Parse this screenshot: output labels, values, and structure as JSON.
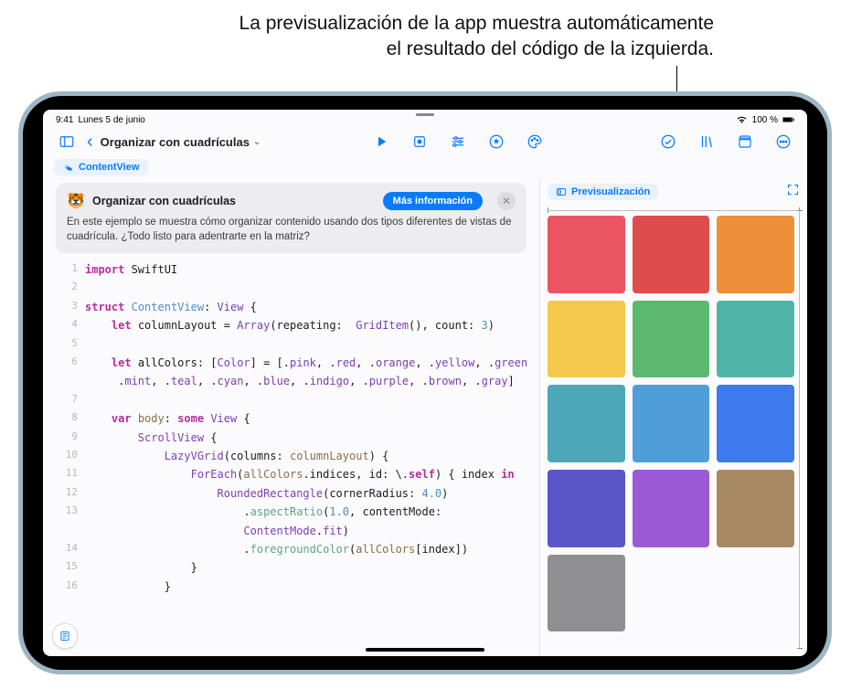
{
  "caption_line1": "La previsualización de la app muestra automáticamente",
  "caption_line2": "el resultado del código de la izquierda.",
  "status": {
    "time": "9:41",
    "date": "Lunes 5 de junio",
    "battery": "100 %",
    "wifi": "􀙇"
  },
  "doc_title": "Organizar con cuadrículas",
  "chips": {
    "contentview": "ContentView",
    "preview": "Previsualización"
  },
  "info": {
    "title": "Organizar con cuadrículas",
    "more": "Más información",
    "body": "En este ejemplo se muestra cómo organizar contenido usando dos tipos diferentes de vistas de cuadrícula. ¿Todo listo para adentrarte en la matriz?"
  },
  "code": {
    "lines": [
      {
        "n": "1",
        "html": "<span class='kw'>import</span> SwiftUI"
      },
      {
        "n": "2",
        "html": ""
      },
      {
        "n": "3",
        "html": "<span class='kw'>struct</span> <span class='type'>ContentView</span>: <span class='typeU'>View</span> {"
      },
      {
        "n": "4",
        "html": "    <span class='kw'>let</span> columnLayout = <span class='typeU'>Array</span>(repeating:  <span class='typeU'>GridItem</span>(), count: <span class='num'>3</span>)"
      },
      {
        "n": "5",
        "html": ""
      },
      {
        "n": "6",
        "html": "    <span class='kw'>let</span> allColors: [<span class='typeU'>Color</span>] = [.<span class='dot'>pink</span>, .<span class='dot'>red</span>, .<span class='dot'>orange</span>, .<span class='dot'>yellow</span>, .<span class='dot'>green</span>,"
      },
      {
        "n": "",
        "html": "     .<span class='dot'>mint</span>, .<span class='dot'>teal</span>, .<span class='dot'>cyan</span>, .<span class='dot'>blue</span>, .<span class='dot'>indigo</span>, .<span class='dot'>purple</span>, .<span class='dot'>brown</span>, .<span class='dot'>gray</span>]"
      },
      {
        "n": "7",
        "html": ""
      },
      {
        "n": "8",
        "html": "    <span class='kw'>var</span> <span class='prop'>body</span>: <span class='kw'>some</span> <span class='typeU'>View</span> {"
      },
      {
        "n": "9",
        "html": "        <span class='typeU'>ScrollView</span> {"
      },
      {
        "n": "10",
        "html": "            <span class='typeU'>LazyVGrid</span>(columns: <span class='prop'>columnLayout</span>) {"
      },
      {
        "n": "11",
        "html": "                <span class='typeU'>ForEach</span>(<span class='prop'>allColors</span>.indices, id: \\.<span class='kw'>self</span>) { index <span class='kw'>in</span>"
      },
      {
        "n": "12",
        "html": "                    <span class='typeU'>RoundedRectangle</span>(cornerRadius: <span class='num'>4.0</span>)"
      },
      {
        "n": "13",
        "html": "                        .<span class='fn'>aspectRatio</span>(<span class='num'>1.0</span>, contentMode:"
      },
      {
        "n": "",
        "html": "                        <span class='typeU'>ContentMode</span>.<span class='dot'>fit</span>)"
      },
      {
        "n": "14",
        "html": "                        .<span class='fn'>foregroundColor</span>(<span class='prop'>allColors</span>[index])"
      },
      {
        "n": "15",
        "html": "                }"
      },
      {
        "n": "16",
        "html": "            }"
      }
    ]
  },
  "grid_colors": [
    "#eb5463",
    "#e04b4b",
    "#ef8f3a",
    "#f2c94c",
    "#5bba6f",
    "#50b4a8",
    "#4da7b8",
    "#4f9ed9",
    "#3b7bec",
    "#5a55c9",
    "#9b59d6",
    "#a78963",
    "#8e8e93"
  ]
}
